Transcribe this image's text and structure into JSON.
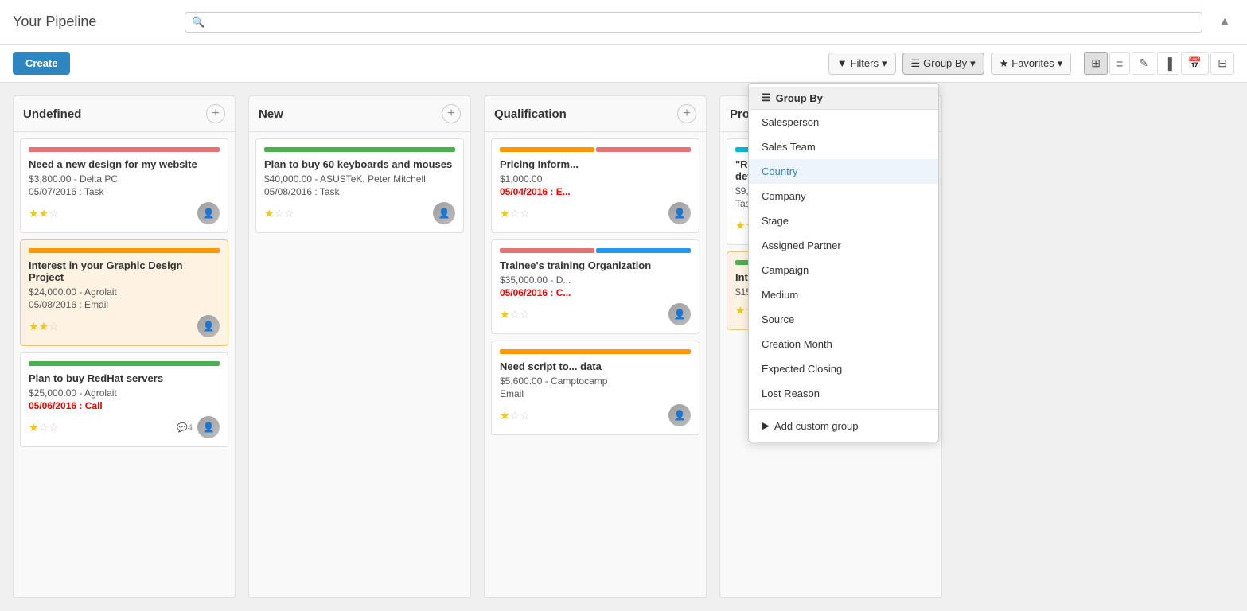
{
  "header": {
    "title": "Your Pipeline",
    "search_placeholder": ""
  },
  "toolbar": {
    "create_label": "Create",
    "filters_label": "Filters",
    "groupby_label": "Group By",
    "favorites_label": "Favorites",
    "views": [
      "kanban",
      "list",
      "edit",
      "chart",
      "calendar",
      "table"
    ]
  },
  "groupby_dropdown": {
    "section_label": "Group By",
    "items": [
      "Salesperson",
      "Sales Team",
      "Country",
      "Company",
      "Stage",
      "Assigned Partner",
      "Campaign",
      "Medium",
      "Source",
      "Creation Month",
      "Expected Closing",
      "Lost Reason"
    ],
    "highlighted": "Country",
    "custom_label": "Add custom group"
  },
  "columns": [
    {
      "id": "undefined",
      "title": "Undefined",
      "add_button": "+",
      "cards": [
        {
          "id": "card1",
          "color": "#e57373",
          "title": "Need a new design for my website",
          "amount": "$3,800.00 - Delta PC",
          "date": "05/07/2016 : Task",
          "date_overdue": false,
          "stars": 2,
          "has_comment": false,
          "comment_count": ""
        },
        {
          "id": "card2",
          "color": "#ff9800",
          "title": "Interest in your Graphic Design Project",
          "amount": "$24,000.00 - Agrolait",
          "date": "05/08/2016 : Email",
          "date_overdue": false,
          "stars": 2,
          "highlighted": true,
          "has_comment": false
        },
        {
          "id": "card3",
          "color": "#4caf50",
          "title": "Plan to buy RedHat servers",
          "amount": "$25,000.00 - Agrolait",
          "date": "05/06/2016 : Call",
          "date_overdue": true,
          "stars": 1,
          "has_comment": true,
          "comment_count": "4"
        }
      ]
    },
    {
      "id": "new",
      "title": "New",
      "add_button": "+",
      "cards": [
        {
          "id": "card4",
          "color": "#4caf50",
          "title": "Plan to buy 60 keyboards and mouses",
          "amount": "$40,000.00 - ASUSTeK, Peter Mitchell",
          "date": "05/08/2016 : Task",
          "date_overdue": false,
          "stars": 1,
          "has_comment": false
        }
      ]
    },
    {
      "id": "qualification",
      "title": "Qualification",
      "add_button": "+",
      "cards": [
        {
          "id": "card5",
          "color_bars": [
            "#ff9800",
            "#e57373"
          ],
          "title": "Pricing Inform...",
          "amount": "$1,000.00",
          "date": "05/04/2016 : E...",
          "date_overdue": true,
          "stars": 1,
          "has_comment": false
        },
        {
          "id": "card6",
          "color_bars": [
            "#e57373",
            "#2196f3"
          ],
          "title": "Trainee's training Organization",
          "amount": "$35,000.00 - D...",
          "date": "05/06/2016 : C...",
          "date_overdue": true,
          "stars": 1,
          "has_comment": false
        },
        {
          "id": "card7",
          "color": "#ff9800",
          "title": "Need script to... data",
          "amount": "$5,600.00 - Camptocamp",
          "date": "Email",
          "date_overdue": false,
          "stars": 1,
          "has_comment": false
        }
      ]
    },
    {
      "id": "proposition",
      "title": "Proposition",
      "add_button": "+",
      "cards": [
        {
          "id": "card8",
          "color": "#00bcd4",
          "title": "\"Resource Planning\" project develpment",
          "amount": "$9,000.00 - Delta PC",
          "date": "Task",
          "date_overdue": false,
          "stars": 2,
          "has_comment": false
        },
        {
          "id": "card9",
          "color": "#4caf50",
          "title": "Interest in your customizable Pcs",
          "amount": "$15,000.00 - Camptocamp",
          "date": "",
          "date_overdue": false,
          "stars": 1,
          "highlighted": true,
          "has_comment": false
        }
      ]
    }
  ]
}
